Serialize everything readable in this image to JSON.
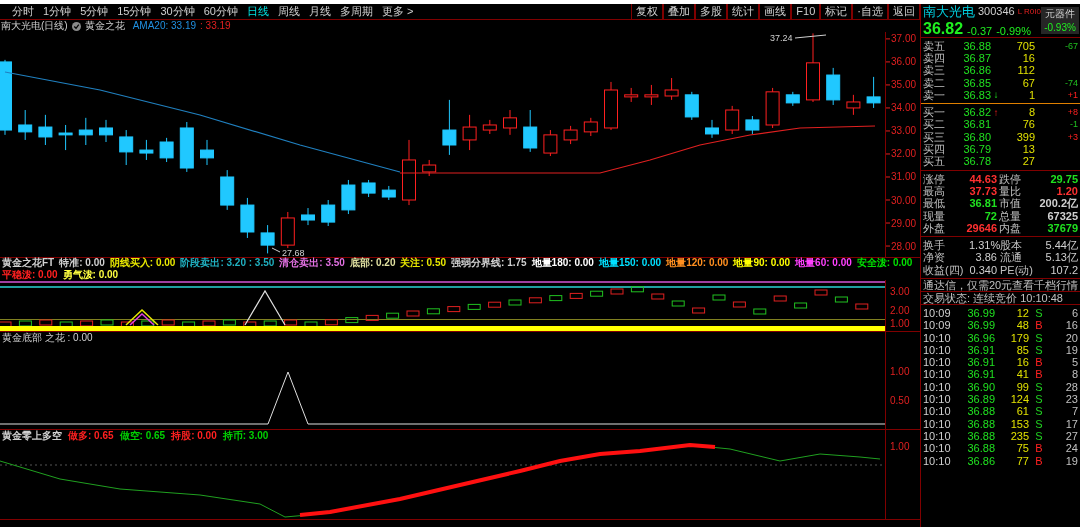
{
  "toolbar": {
    "periods": [
      {
        "label": "分时",
        "selected": false
      },
      {
        "label": "1分钟",
        "selected": false
      },
      {
        "label": "5分钟",
        "selected": false
      },
      {
        "label": "15分钟",
        "selected": false
      },
      {
        "label": "30分钟",
        "selected": false
      },
      {
        "label": "60分钟",
        "selected": false
      },
      {
        "label": "日线",
        "selected": true
      },
      {
        "label": "周线",
        "selected": false
      },
      {
        "label": "月线",
        "selected": false
      },
      {
        "label": "多周期",
        "selected": false
      },
      {
        "label": "更多 >",
        "selected": false
      }
    ],
    "buttons": [
      "复权",
      "叠加",
      "多股",
      "统计",
      "画线",
      "F10",
      "标记",
      "·自选",
      "返回"
    ]
  },
  "chart_title": {
    "stock": "南大光电(日线)",
    "indicator": "黄金之花",
    "ama": "AMA20: 33.19",
    "ama_value": ": 33.19"
  },
  "price_chart": {
    "high_marker": "37.24",
    "low_marker": "27.68",
    "chart_data": {
      "type": "candlestick",
      "ohlc": [
        [
          36.0,
          36.09,
          32.83,
          33.04
        ],
        [
          33.26,
          33.91,
          32.61,
          32.96
        ],
        [
          33.17,
          33.7,
          32.39,
          32.74
        ],
        [
          32.91,
          33.26,
          32.17,
          32.83
        ],
        [
          33.04,
          33.57,
          32.39,
          32.83
        ],
        [
          33.13,
          33.48,
          32.52,
          32.83
        ],
        [
          32.74,
          33.04,
          31.52,
          32.09
        ],
        [
          32.17,
          32.61,
          31.74,
          32.04
        ],
        [
          32.52,
          32.7,
          31.65,
          31.83
        ],
        [
          33.13,
          33.39,
          31.22,
          31.39
        ],
        [
          32.17,
          32.61,
          31.52,
          31.83
        ],
        [
          31.0,
          31.3,
          29.57,
          29.78
        ],
        [
          29.78,
          30.09,
          28.35,
          28.61
        ],
        [
          28.57,
          28.91,
          27.68,
          28.04
        ],
        [
          28.04,
          29.48,
          27.91,
          29.22
        ],
        [
          29.35,
          29.65,
          28.91,
          29.13
        ],
        [
          29.78,
          30.0,
          28.87,
          29.04
        ],
        [
          30.65,
          30.87,
          29.39,
          29.57
        ],
        [
          30.74,
          30.87,
          30.13,
          30.3
        ],
        [
          30.43,
          30.61,
          30.0,
          30.13
        ],
        [
          30.0,
          32.61,
          29.78,
          31.74
        ],
        [
          31.22,
          31.74,
          31.04,
          31.52
        ],
        [
          33.04,
          34.35,
          31.96,
          32.39
        ],
        [
          32.61,
          33.7,
          32.17,
          33.17
        ],
        [
          33.04,
          33.48,
          32.87,
          33.26
        ],
        [
          33.13,
          33.91,
          32.83,
          33.57
        ],
        [
          33.17,
          33.91,
          32.09,
          32.26
        ],
        [
          32.04,
          33.04,
          31.91,
          32.83
        ],
        [
          32.61,
          33.22,
          32.43,
          33.04
        ],
        [
          32.96,
          33.57,
          32.78,
          33.39
        ],
        [
          33.13,
          35.13,
          33.04,
          34.78
        ],
        [
          34.48,
          34.87,
          34.26,
          34.57
        ],
        [
          34.48,
          35.0,
          34.13,
          34.57
        ],
        [
          34.52,
          35.3,
          34.35,
          34.78
        ],
        [
          34.57,
          34.7,
          33.48,
          33.61
        ],
        [
          33.13,
          33.48,
          32.7,
          32.87
        ],
        [
          33.04,
          34.09,
          32.87,
          33.91
        ],
        [
          33.48,
          33.65,
          32.87,
          33.04
        ],
        [
          33.26,
          34.87,
          33.13,
          34.7
        ],
        [
          34.57,
          34.7,
          34.09,
          34.22
        ],
        [
          34.35,
          37.24,
          34.26,
          35.96
        ],
        [
          35.43,
          35.74,
          34.13,
          34.35
        ],
        [
          34.0,
          34.57,
          33.7,
          34.26
        ],
        [
          34.48,
          35.35,
          34.0,
          34.22
        ]
      ],
      "ylim": [
        27.48,
        37.3
      ],
      "yticks": [
        {
          "value": 37,
          "label": "37.00"
        },
        {
          "value": 36,
          "label": "36.00"
        },
        {
          "value": 35,
          "label": "35.00"
        },
        {
          "value": 34,
          "label": "34.00"
        },
        {
          "value": 33,
          "label": "33.00"
        },
        {
          "value": 32,
          "label": "32.00"
        },
        {
          "value": 31,
          "label": "31.00"
        },
        {
          "value": 30,
          "label": "30.00"
        },
        {
          "value": 29,
          "label": "29.00"
        },
        {
          "value": 28,
          "label": "28.00"
        }
      ]
    }
  },
  "indicator_1": {
    "labels": [
      {
        "text": "黄金之花FT",
        "color": "#d0d0d0"
      },
      {
        "text": "特准: 0.00",
        "color": "#d0d0d0"
      },
      {
        "text": "阴线买入: 0.00",
        "color": "#e8e800"
      },
      {
        "text": "阶段卖出: 3.20 : 3.50",
        "color": "#20b0c0"
      },
      {
        "text": "清仓卖出: 3.50",
        "color": "#e070e0"
      },
      {
        "text": "底部: 0.20",
        "color": "#e0e0a0"
      },
      {
        "text": "关注: 0.50",
        "color": "#e8e800"
      },
      {
        "text": "强弱分界线: 1.75",
        "color": "#d0d0d0"
      },
      {
        "text": "地量180: 0.00",
        "color": "#ffffff"
      },
      {
        "text": "地量150: 0.00",
        "color": "#00e0ff"
      },
      {
        "text": "地量120: 0.00",
        "color": "#ff9020"
      },
      {
        "text": "地量90: 0.00",
        "color": "#ffff00"
      },
      {
        "text": "地量60: 0.00",
        "color": "#ff40ff"
      },
      {
        "text": "安全泼: 0.00",
        "color": "#00e000"
      },
      {
        "text": "平稳泼: 0.00",
        "color": "#ff2020"
      },
      {
        "text": "勇气泼: 0.00",
        "color": "#ffff40"
      }
    ],
    "axis": [
      "3.00",
      "2.00",
      "1.00"
    ]
  },
  "indicator_2": {
    "label": "黄金底部 之花 : 0.00",
    "axis": [
      "1.00",
      "0.50"
    ]
  },
  "indicator_3": {
    "labels": [
      {
        "text": "黄金零上多空",
        "color": "#d0d0d0"
      },
      {
        "text": "做多: 0.65",
        "color": "#ff2020"
      },
      {
        "text": "做空: 0.65",
        "color": "#00d000"
      },
      {
        "text": "持股: 0.00",
        "color": "#ff2020"
      },
      {
        "text": "持币: 3.00",
        "color": "#00d000"
      }
    ],
    "axis": [
      "1.00"
    ]
  },
  "quote": {
    "name": "南大光电",
    "code": "300346",
    "flags": "L R0I0",
    "sector": "元器件",
    "sector_change": "-0.93%",
    "price": "36.82",
    "change": "-0.37",
    "change_pct": "-0.99%"
  },
  "order_book": {
    "asks": [
      {
        "label": "卖五",
        "price": "36.88",
        "volume": "705",
        "delta": "-67"
      },
      {
        "label": "卖四",
        "price": "36.87",
        "volume": "16"
      },
      {
        "label": "卖三",
        "price": "36.86",
        "volume": "112"
      },
      {
        "label": "卖二",
        "price": "36.85",
        "volume": "67",
        "delta": "-74"
      },
      {
        "label": "卖一",
        "price": "36.83",
        "volume": "1",
        "delta": "+1",
        "arrow": "↓"
      }
    ],
    "bids": [
      {
        "label": "买一",
        "price": "36.82",
        "volume": "8",
        "delta": "+8",
        "arrow": "↑"
      },
      {
        "label": "买二",
        "price": "36.81",
        "volume": "76",
        "delta": "-1"
      },
      {
        "label": "买三",
        "price": "36.80",
        "volume": "399",
        "delta": "+3"
      },
      {
        "label": "买四",
        "price": "36.79",
        "volume": "13"
      },
      {
        "label": "买五",
        "price": "36.78",
        "volume": "27"
      }
    ]
  },
  "stats": [
    {
      "label": "涨停",
      "value": "44.63",
      "color": "#ff3030"
    },
    {
      "label": "跌停",
      "value": "29.75",
      "color": "#20e020"
    },
    {
      "label": "最高",
      "value": "37.73",
      "color": "#ff3030"
    },
    {
      "label": "量比",
      "value": "1.20",
      "color": "#ff3030"
    },
    {
      "label": "最低",
      "value": "36.81",
      "color": "#20e020"
    },
    {
      "label": "市值",
      "value": "200.2亿",
      "color": "#d0d0d0"
    },
    {
      "label": "现量",
      "value": "72",
      "color": "#20e020"
    },
    {
      "label": "总量",
      "value": "67325",
      "color": "#d0d0d0"
    },
    {
      "label": "外盘",
      "value": "29646",
      "color": "#ff3030"
    },
    {
      "label": "内盘",
      "value": "37679",
      "color": "#20e020"
    }
  ],
  "fundamentals": [
    {
      "label": "换手",
      "value": "1.31%",
      "label_2": "股本",
      "value_2": "5.44亿"
    },
    {
      "label": "净资",
      "value": "3.86",
      "label_2": "流通",
      "value_2": "5.13亿"
    },
    {
      "label": "收益(四)",
      "value": "0.340",
      "label_2": "PE(动)",
      "value_2": "107.2"
    }
  ],
  "notice": "通达信，仅需20元查看千档行情",
  "trade_status": "交易状态: 连续竞价 10:10:48",
  "ticks": [
    {
      "time": "10:09",
      "price": "36.99",
      "volume": "12",
      "side": "S",
      "count": "6"
    },
    {
      "time": "10:09",
      "price": "36.99",
      "volume": "48",
      "side": "B",
      "count": "16"
    },
    {
      "time": "10:10",
      "price": "36.96",
      "volume": "179",
      "side": "S",
      "count": "20"
    },
    {
      "time": "10:10",
      "price": "36.91",
      "volume": "85",
      "side": "S",
      "count": "19"
    },
    {
      "time": "10:10",
      "price": "36.91",
      "volume": "16",
      "side": "B",
      "count": "5"
    },
    {
      "time": "10:10",
      "price": "36.91",
      "volume": "41",
      "side": "B",
      "count": "8"
    },
    {
      "time": "10:10",
      "price": "36.90",
      "volume": "99",
      "side": "S",
      "count": "28"
    },
    {
      "time": "10:10",
      "price": "36.89",
      "volume": "124",
      "side": "S",
      "count": "23"
    },
    {
      "time": "10:10",
      "price": "36.88",
      "volume": "61",
      "side": "S",
      "count": "7"
    },
    {
      "time": "10:10",
      "price": "36.88",
      "volume": "153",
      "side": "S",
      "count": "17"
    },
    {
      "time": "10:10",
      "price": "36.88",
      "volume": "235",
      "side": "S",
      "count": "27"
    },
    {
      "time": "10:10",
      "price": "36.88",
      "volume": "75",
      "side": "B",
      "count": "24"
    },
    {
      "time": "10:10",
      "price": "36.86",
      "volume": "77",
      "side": "B",
      "count": "19"
    }
  ]
}
